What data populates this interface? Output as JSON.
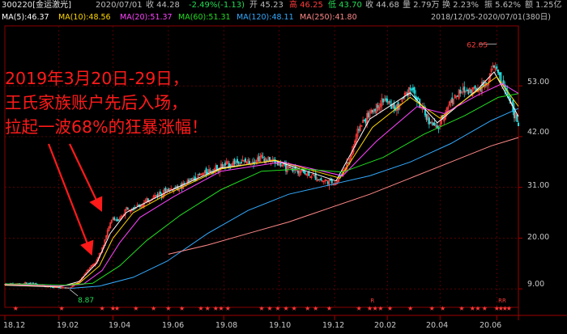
{
  "header": {
    "code_name": "300220[金运激光]",
    "date": "2020/07/01",
    "close": "收 44.28",
    "change": "-2.49%(-1.13)",
    "open": "开 45.23",
    "high": "高 46.25",
    "low": "低 43.70",
    "last": "收 44.68",
    "volume": "量 2.79万",
    "turnover": "换 2.23%",
    "amplitude": "振 5.62%",
    "amount": "额 1.25亿"
  },
  "ma_legend": {
    "ma5": "MA(5):46.37",
    "ma10": "MA(10):48.56",
    "ma20": "MA(20):51.37",
    "ma60": "MA(60):51.31",
    "ma120": "MA(120):48.11",
    "ma250": "MA(250):41.80",
    "range": "2018/12/05-2020/07/01(380日)"
  },
  "annotation": {
    "line1": "2019年3月20日-29日，",
    "line2": "王氏家族账户先后入场，",
    "line3": "拉起一波68%的狂暴涨幅！"
  },
  "markers": {
    "high_label": "62.05",
    "low_label": "8.87",
    "r_labels": [
      "R",
      "RR"
    ]
  },
  "colors": {
    "up": "#ff3b3b",
    "down": "#22dddd",
    "ma5": "#ffffff",
    "ma10": "#ffd700",
    "ma20": "#ff44ff",
    "ma60": "#22dd22",
    "ma120": "#33aaff",
    "ma250": "#ff8888",
    "grid": "#8b0000"
  },
  "chart_data": {
    "type": "candlestick",
    "y_ticks": [
      "53.00",
      "42.00",
      "31.00",
      "20.00",
      "9.00"
    ],
    "y_tick_values": [
      53,
      42,
      31,
      20,
      9
    ],
    "ylim": [
      5,
      66
    ],
    "x_ticks": [
      "18.12",
      "19.02",
      "19.04",
      "19.06",
      "19.08",
      "19.10",
      "19.12",
      "20.02",
      "20.04",
      "20.06"
    ],
    "xlim": [
      0,
      380
    ],
    "x_tick_positions": [
      0,
      40,
      80,
      121,
      162,
      203,
      244,
      283,
      322,
      364
    ],
    "close_path": [
      [
        0,
        10.0
      ],
      [
        20,
        10.2
      ],
      [
        35,
        9.4
      ],
      [
        48,
        9.2
      ],
      [
        55,
        10.5
      ],
      [
        62,
        13.5
      ],
      [
        68,
        15.0
      ],
      [
        72,
        18.0
      ],
      [
        76,
        21.5
      ],
      [
        80,
        24.5
      ],
      [
        84,
        23.5
      ],
      [
        90,
        26.5
      ],
      [
        100,
        27.0
      ],
      [
        110,
        29.0
      ],
      [
        120,
        30.5
      ],
      [
        130,
        31.0
      ],
      [
        140,
        33.0
      ],
      [
        150,
        34.5
      ],
      [
        160,
        35.5
      ],
      [
        170,
        36.5
      ],
      [
        180,
        36.5
      ],
      [
        190,
        37.5
      ],
      [
        200,
        36.5
      ],
      [
        210,
        35.0
      ],
      [
        220,
        34.5
      ],
      [
        235,
        32.5
      ],
      [
        245,
        32.0
      ],
      [
        255,
        37.0
      ],
      [
        262,
        44.0
      ],
      [
        270,
        47.0
      ],
      [
        280,
        50.0
      ],
      [
        290,
        48.0
      ],
      [
        300,
        53.0
      ],
      [
        310,
        47.0
      ],
      [
        320,
        43.5
      ],
      [
        330,
        50.0
      ],
      [
        340,
        52.0
      ],
      [
        350,
        52.5
      ],
      [
        357,
        54.0
      ],
      [
        362,
        57.5
      ],
      [
        368,
        53.5
      ],
      [
        374,
        50.0
      ],
      [
        380,
        44.28
      ]
    ],
    "ma_series": [
      {
        "name": "MA(5)",
        "color_key": "ma5",
        "values": [
          [
            0,
            9.8
          ],
          [
            40,
            9.4
          ],
          [
            55,
            10.6
          ],
          [
            68,
            14.6
          ],
          [
            78,
            21.0
          ],
          [
            90,
            25.6
          ],
          [
            120,
            30.0
          ],
          [
            160,
            35.2
          ],
          [
            200,
            36.8
          ],
          [
            245,
            32.4
          ],
          [
            270,
            45.8
          ],
          [
            300,
            51.5
          ],
          [
            320,
            45.0
          ],
          [
            350,
            52.3
          ],
          [
            362,
            56.0
          ],
          [
            380,
            46.37
          ]
        ]
      },
      {
        "name": "MA(10)",
        "color_key": "ma10",
        "values": [
          [
            0,
            9.9
          ],
          [
            40,
            9.5
          ],
          [
            55,
            10.2
          ],
          [
            70,
            14.0
          ],
          [
            80,
            20.0
          ],
          [
            95,
            25.5
          ],
          [
            120,
            29.5
          ],
          [
            160,
            35.0
          ],
          [
            200,
            36.9
          ],
          [
            248,
            33.0
          ],
          [
            272,
            44.0
          ],
          [
            300,
            50.5
          ],
          [
            322,
            46.0
          ],
          [
            350,
            52.0
          ],
          [
            364,
            55.0
          ],
          [
            380,
            48.56
          ]
        ]
      },
      {
        "name": "MA(20)",
        "color_key": "ma20",
        "values": [
          [
            0,
            10.0
          ],
          [
            40,
            9.6
          ],
          [
            58,
            10.0
          ],
          [
            72,
            13.0
          ],
          [
            85,
            19.0
          ],
          [
            100,
            24.5
          ],
          [
            125,
            29.0
          ],
          [
            160,
            34.5
          ],
          [
            205,
            36.5
          ],
          [
            250,
            33.5
          ],
          [
            275,
            41.0
          ],
          [
            305,
            48.5
          ],
          [
            325,
            47.0
          ],
          [
            350,
            51.0
          ],
          [
            368,
            53.5
          ],
          [
            380,
            51.37
          ]
        ]
      },
      {
        "name": "MA(60)",
        "color_key": "ma60",
        "values": [
          [
            0,
            10.1
          ],
          [
            45,
            9.8
          ],
          [
            65,
            10.2
          ],
          [
            85,
            14.0
          ],
          [
            105,
            19.5
          ],
          [
            130,
            25.0
          ],
          [
            160,
            30.5
          ],
          [
            190,
            34.5
          ],
          [
            220,
            35.0
          ],
          [
            250,
            34.3
          ],
          [
            280,
            37.5
          ],
          [
            310,
            42.5
          ],
          [
            340,
            46.5
          ],
          [
            365,
            50.5
          ],
          [
            380,
            51.31
          ]
        ]
      },
      {
        "name": "MA(120)",
        "color_key": "ma120",
        "values": [
          [
            48,
            9.1
          ],
          [
            70,
            9.6
          ],
          [
            95,
            11.5
          ],
          [
            120,
            15.0
          ],
          [
            150,
            21.0
          ],
          [
            180,
            26.0
          ],
          [
            210,
            29.5
          ],
          [
            240,
            31.5
          ],
          [
            270,
            33.5
          ],
          [
            300,
            36.5
          ],
          [
            330,
            40.5
          ],
          [
            360,
            45.5
          ],
          [
            380,
            48.11
          ]
        ]
      },
      {
        "name": "MA(250)",
        "color_key": "ma250",
        "values": [
          [
            121,
            16.5
          ],
          [
            150,
            18.5
          ],
          [
            180,
            21.0
          ],
          [
            210,
            23.5
          ],
          [
            240,
            26.5
          ],
          [
            270,
            29.5
          ],
          [
            300,
            33.0
          ],
          [
            330,
            36.5
          ],
          [
            360,
            40.0
          ],
          [
            380,
            41.8
          ]
        ]
      }
    ],
    "high_point": {
      "x": 364,
      "y": 62.05
    },
    "low_point": {
      "x": 48,
      "y": 8.87
    }
  }
}
